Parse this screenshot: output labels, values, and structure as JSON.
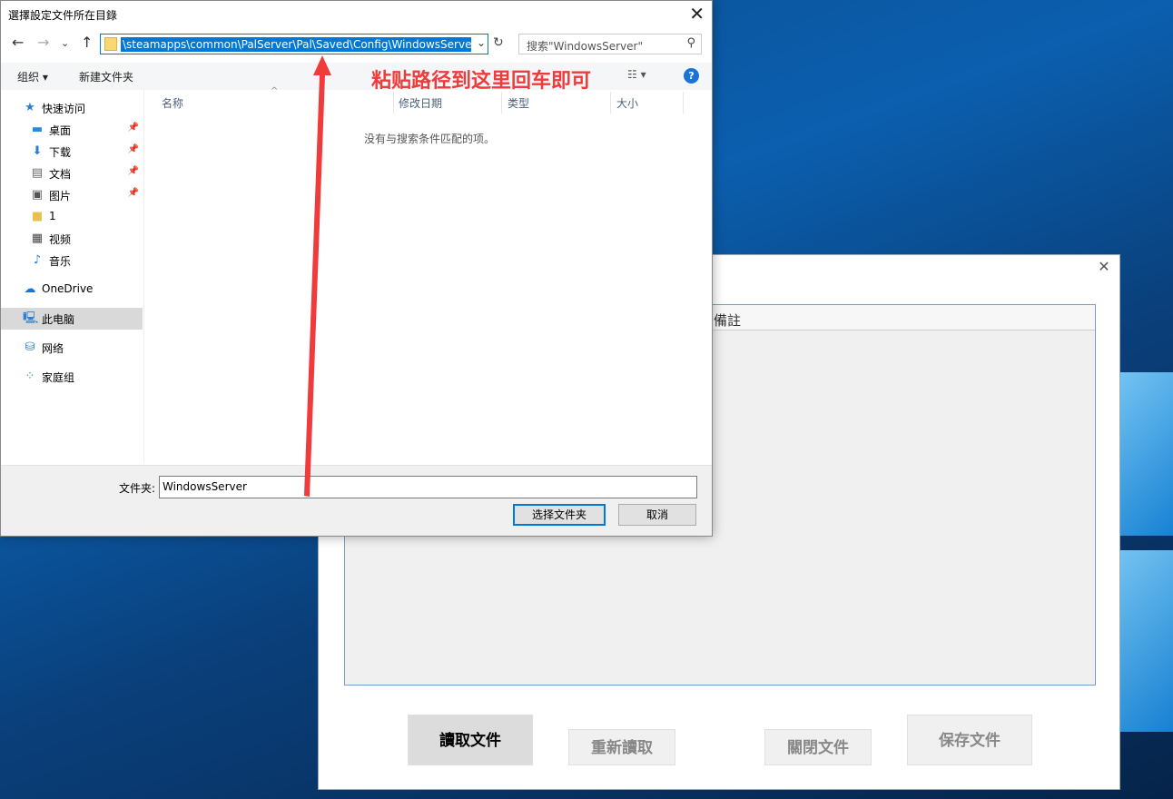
{
  "dialog": {
    "title": "選擇設定文件所在目錄",
    "address_path": "\\steamapps\\common\\PalServer\\Pal\\Saved\\Config\\WindowsServer",
    "search_placeholder": "搜索\"WindowsServer\"",
    "toolbar": {
      "organize": "组织 ▾",
      "new_folder": "新建文件夹"
    },
    "annotation": "粘贴路径到这里回车即可",
    "sidebar": [
      {
        "label": "快速访问",
        "icon": "star-icon"
      },
      {
        "label": "桌面",
        "icon": "desktop-icon",
        "pinned": true
      },
      {
        "label": "下载",
        "icon": "download-icon",
        "pinned": true
      },
      {
        "label": "文档",
        "icon": "document-icon",
        "pinned": true
      },
      {
        "label": "图片",
        "icon": "picture-icon",
        "pinned": true
      },
      {
        "label": "1",
        "icon": "folder-icon"
      },
      {
        "label": "视频",
        "icon": "video-icon"
      },
      {
        "label": "音乐",
        "icon": "music-icon"
      },
      {
        "label": "OneDrive",
        "icon": "cloud-icon"
      },
      {
        "label": "此电脑",
        "icon": "computer-icon",
        "selected": true
      },
      {
        "label": "网络",
        "icon": "network-icon"
      },
      {
        "label": "家庭组",
        "icon": "homegroup-icon"
      }
    ],
    "columns": [
      "名称",
      "修改日期",
      "类型",
      "大小"
    ],
    "empty_message": "没有与搜索条件匹配的项。",
    "folder_label": "文件夹:",
    "folder_value": "WindowsServer",
    "select_button": "选择文件夹",
    "cancel_button": "取消"
  },
  "app": {
    "panel_header": "備註",
    "buttons": {
      "read": "讀取文件",
      "reload": "重新讀取",
      "close": "關閉文件",
      "save": "保存文件"
    }
  },
  "colors": {
    "accent": "#0078d7",
    "annotation": "#ef3b3b"
  }
}
